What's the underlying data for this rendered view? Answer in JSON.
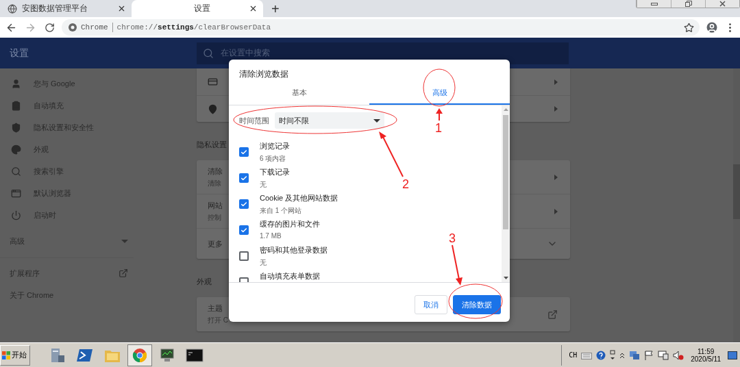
{
  "browser": {
    "tabs": [
      {
        "title": "安图数据管理平台",
        "selected": false
      },
      {
        "title": "设置",
        "selected": true
      }
    ],
    "new_tab": "+",
    "address": {
      "scheme_label": "Chrome",
      "url": "chrome://**settings**/clearBrowserData"
    }
  },
  "settings": {
    "title": "设置",
    "search": {
      "placeholder": "在设置中搜索"
    },
    "sidebar": {
      "items": [
        {
          "label": "您与 Google"
        },
        {
          "label": "自动填充"
        },
        {
          "label": "隐私设置和安全性"
        },
        {
          "label": "外观"
        },
        {
          "label": "搜索引擎"
        },
        {
          "label": "默认浏览器"
        },
        {
          "label": "启动时"
        }
      ],
      "advanced": {
        "label": "高级",
        "expanded": false
      },
      "extensions": "扩展程序",
      "about": "关于 Chrome"
    },
    "sections": [
      {
        "rows": [
          {
            "kind": "icon"
          },
          {
            "kind": "icon"
          }
        ]
      },
      {
        "heading": "隐私设置",
        "rows": [
          {
            "kind": "link",
            "title": "清除",
            "subtitle": "清除"
          },
          {
            "kind": "link",
            "title": "网站",
            "subtitle": "控制"
          },
          {
            "kind": "expand",
            "title": "更多"
          }
        ]
      },
      {
        "heading": "外观",
        "rows": [
          {
            "kind": "external",
            "title": "主题",
            "subtitle": "打开 C"
          }
        ]
      }
    ]
  },
  "dialog": {
    "title": "清除浏览数据",
    "tabs": [
      {
        "label": "基本",
        "selected": false
      },
      {
        "label": "高级",
        "selected": true
      }
    ],
    "time_range": {
      "label": "时间范围",
      "value": "时间不限"
    },
    "items": [
      {
        "title": "浏览记录",
        "subtitle": "6 项内容",
        "checked": true
      },
      {
        "title": "下载记录",
        "subtitle": "无",
        "checked": true
      },
      {
        "title": "Cookie 及其他网站数据",
        "subtitle": "来自 1 个网站",
        "checked": true
      },
      {
        "title": "缓存的图片和文件",
        "subtitle": "1.7 MB",
        "checked": true
      },
      {
        "title": "密码和其他登录数据",
        "subtitle": "无",
        "checked": false
      },
      {
        "title": "自动填充表单数据",
        "checked": false
      }
    ],
    "buttons": {
      "cancel": "取消",
      "confirm": "清除数据"
    }
  },
  "annotations": [
    {
      "label": "1"
    },
    {
      "label": "2"
    },
    {
      "label": "3"
    }
  ],
  "taskbar": {
    "start": "开始",
    "input_method": "CH",
    "time": "11:59",
    "date": "2020/5/11"
  }
}
